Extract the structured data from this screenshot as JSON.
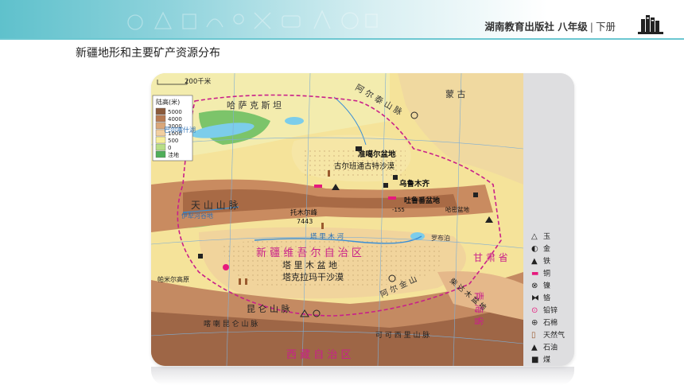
{
  "header": {
    "publisher": "湖南教育出版社",
    "grade": "八年级",
    "volume": "下册"
  },
  "page_title": "新疆地形和主要矿产资源分布",
  "map": {
    "scale_label": "200千米",
    "elevation_legend": {
      "title": "陆高(米)",
      "levels": [
        {
          "label": "5000",
          "color": "#8a5a3c"
        },
        {
          "label": "4000",
          "color": "#b77a52"
        },
        {
          "label": "3000",
          "color": "#d9a77a"
        },
        {
          "label": "1000",
          "color": "#f2cfa0"
        },
        {
          "label": "500",
          "color": "#f7ee9a"
        },
        {
          "label": "0",
          "color": "#b7de86"
        },
        {
          "label": "洼地",
          "color": "#4fae5a"
        }
      ]
    },
    "region_labels": {
      "kazakhstan": "哈 萨 克 斯 坦",
      "mongolia": "蒙    古",
      "altai": "阿  尔  泰  山  脉",
      "junggar": "准噶尔盆地",
      "gurbantunggut": "古尔班通古特沙漠",
      "urumqi": "乌鲁木齐",
      "turpan": "吐鲁番盆地",
      "hami": "哈密盆地",
      "tianshan": "天    山    山    脉",
      "tomur": "托木尔峰",
      "tomur_height": "7443",
      "xinjiang": "新 疆 维 吾 尔 自 治 区",
      "tarim": "塔 里 木 盆 地",
      "taklimakan": "塔克拉玛干沙漠",
      "gansu": "甘 肃 省",
      "qinghai": "青 海 省",
      "xizang": "西    藏    自    治    区",
      "altun": "阿 尔 金 山",
      "kunlun": "昆    仑    山    脉",
      "karakoram": "喀 喇 昆 仑 山 脉",
      "qaidam": "柴 达 木 盆 地",
      "hoh_xil": "可 可 西 里 山 脉",
      "pamir": "帕米尔高原",
      "balkhash": "巴尔喀什湖",
      "lop": "罗布泊",
      "tarim_river": "塔 里 木 河",
      "ili": "伊犁河谷地",
      "turpan_depth": "-155"
    },
    "mineral_legend": [
      {
        "symbol": "△",
        "label": "玉"
      },
      {
        "symbol": "◐",
        "label": "金"
      },
      {
        "symbol": "▲",
        "label": "铁"
      },
      {
        "symbol": "▬",
        "label": "铜"
      },
      {
        "symbol": "⊗",
        "label": "镍"
      },
      {
        "symbol": "⧓",
        "label": "铬"
      },
      {
        "symbol": "⊙",
        "label": "铅锌"
      },
      {
        "symbol": "⊕",
        "label": "石棉"
      },
      {
        "symbol": "▯",
        "label": "天然气"
      },
      {
        "symbol": "▲",
        "label": "石油"
      },
      {
        "symbol": "■",
        "label": "煤"
      }
    ]
  }
}
